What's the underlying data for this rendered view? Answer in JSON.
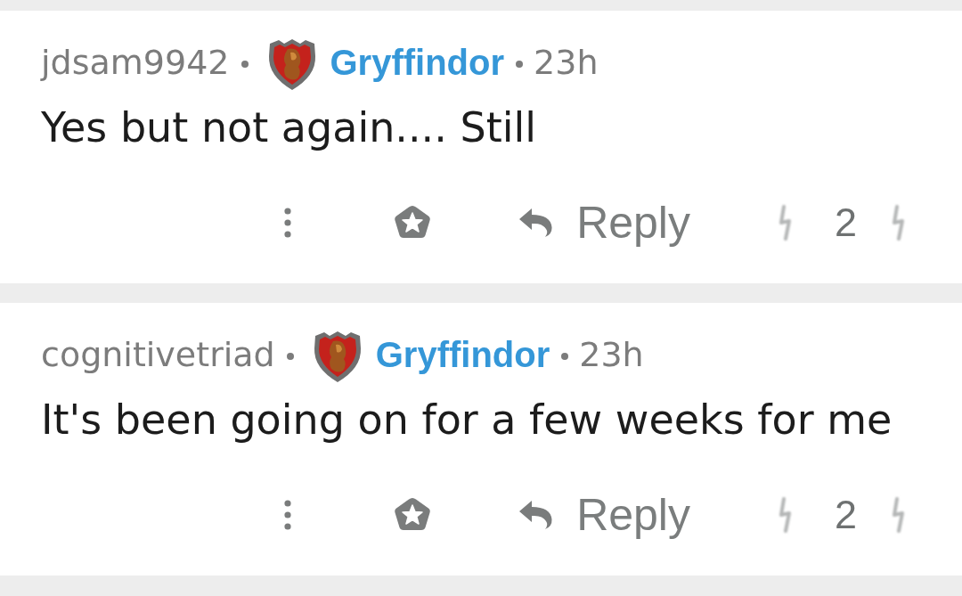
{
  "comments": [
    {
      "author": "jdsam9942",
      "flair": "Gryffindor",
      "age": "23h",
      "body": "Yes but not again.... Still",
      "reply_label": "Reply",
      "score": "2"
    },
    {
      "author": "cognitivetriad",
      "flair": "Gryffindor",
      "age": "23h",
      "body": "It's been going on for a few weeks for me",
      "reply_label": "Reply",
      "score": "2"
    }
  ]
}
